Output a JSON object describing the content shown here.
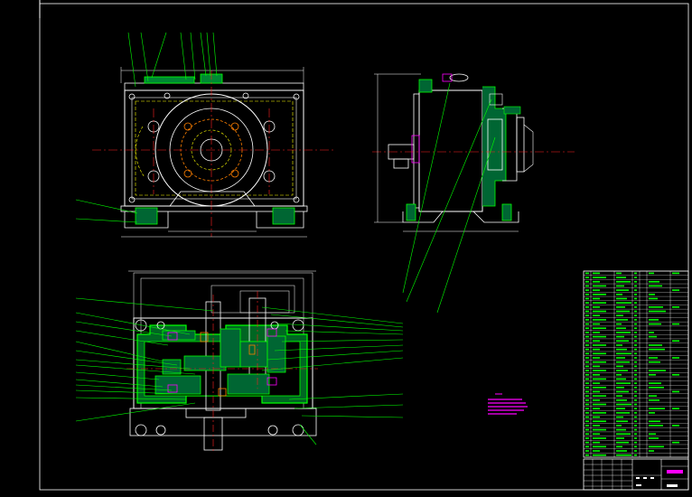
{
  "colors": {
    "background": "#000000",
    "outline": "#ffffff",
    "part": "#00ff00",
    "centerline": "#ff2020",
    "hidden": "#ffff00",
    "accent": "#ff00ff",
    "cyan": "#00ffff",
    "orange": "#ff8000"
  },
  "drawing": {
    "views": [
      "front-view",
      "side-view",
      "top-section-view"
    ],
    "parts_list_rows": 44,
    "balloon_count_front": 8,
    "balloon_count_left": 17,
    "balloon_count_right": 12,
    "notes_line_count": 5
  }
}
